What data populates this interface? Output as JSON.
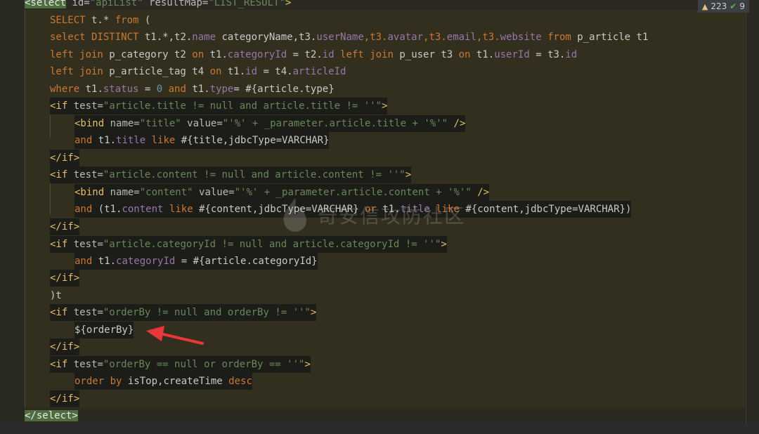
{
  "status": {
    "warnings": "223",
    "checks": "9"
  },
  "watermark": {
    "text": "奇安信攻防社区"
  },
  "code": {
    "l0": {
      "a": "<select",
      "b": " id=",
      "c": "\"apiList\"",
      "d": " resultMap=",
      "e": "\"LIST_RESULT\"",
      "f": ">"
    },
    "l1": {
      "a": "SELECT",
      "b": " t.* ",
      "c": "from",
      "d": " ("
    },
    "l2": {
      "a": "select DISTINCT",
      "b": " t1.*,t2.",
      "c": "name",
      "d": " categoryName,t3.",
      "e": "userName",
      "f": ",t3.",
      "g": "avatar",
      "h": ",t3.",
      "i": "email",
      "j": ",t3.",
      "k": "website",
      "l": " ",
      "m": "from",
      "n": " p_article t1"
    },
    "l3": {
      "a": "left join",
      "b": " p_category t2 ",
      "c": "on",
      "d": " t1.",
      "e": "categoryId",
      "f": " = t2.",
      "g": "id",
      "h": " ",
      "i": "left join",
      "j": " p_user t3 ",
      "k": "on",
      "l": " t1.",
      "m": "userId",
      "n": " = t3.",
      "o": "id"
    },
    "l4": {
      "a": "left join",
      "b": " p_article_tag t4 ",
      "c": "on",
      "d": " t1.",
      "e": "id",
      "f": " = t4.",
      "g": "articleId"
    },
    "l5": {
      "a": "where",
      "b": " t1.",
      "c": "status",
      "d": " = ",
      "e": "0",
      "f": " ",
      "g": "and",
      "h": " t1.",
      "i": "type",
      "j": "= #{article.type}"
    },
    "l6": {
      "a": "<if",
      "b": " test=",
      "c": "\"article.title != null and article.title != ''\"",
      "d": ">"
    },
    "l7": {
      "a": "<bind",
      "b": " name=",
      "c": "\"title\"",
      "d": " value=",
      "e": "\"'%' + _parameter.article.title + '%'\"",
      "f": " />"
    },
    "l8": {
      "a": "and",
      "b": " t1.",
      "c": "title",
      "d": " ",
      "e": "like",
      "f": " #{title,jdbcType=VARCHAR}"
    },
    "l9": {
      "a": "</if>"
    },
    "l10": {
      "a": "<if",
      "b": " test=",
      "c": "\"article.content != null and article.content != ''\"",
      "d": ">"
    },
    "l11": {
      "a": "<bind",
      "b": " name=",
      "c": "\"content\"",
      "d": " value=",
      "e": "\"'%' + _parameter.article.content + '%'\"",
      "f": " />"
    },
    "l12": {
      "a": "and",
      "b": " (t1.",
      "c": "content",
      "d": " ",
      "e": "like",
      "f": " #{content,jdbcType=VARCHAR} ",
      "g": "or",
      "h": " t1.",
      "i": "title",
      "j": " ",
      "k": "like",
      "l": " #{content,jdbcType=VARCHAR})"
    },
    "l13": {
      "a": "</if>"
    },
    "l14": {
      "a": "<if",
      "b": " test=",
      "c": "\"article.categoryId != null and article.categoryId != ''\"",
      "d": ">"
    },
    "l15": {
      "a": "and",
      "b": " t1.",
      "c": "categoryId",
      "d": " = #{article.categoryId}"
    },
    "l16": {
      "a": "</if>"
    },
    "l17": {
      "a": ")t"
    },
    "l18": {
      "a": "<if",
      "b": " test=",
      "c": "\"orderBy != null and orderBy != ''\"",
      "d": ">"
    },
    "l19": {
      "a": "${orderBy}"
    },
    "l20": {
      "a": "</if>"
    },
    "l21": {
      "a": "<if",
      "b": " test=",
      "c": "\"orderBy == null or orderBy == ''\"",
      "d": ">"
    },
    "l22": {
      "a": "order by",
      "b": " isTop,createTime ",
      "c": "desc"
    },
    "l23": {
      "a": "</if>"
    },
    "l24": {
      "a": "</select>"
    }
  },
  "colors": {
    "keyword": "#cc7832",
    "field": "#9876aa",
    "string": "#6a8759",
    "number": "#6897bb",
    "tag": "#e8bf6a",
    "arrow": "#e8363a"
  }
}
